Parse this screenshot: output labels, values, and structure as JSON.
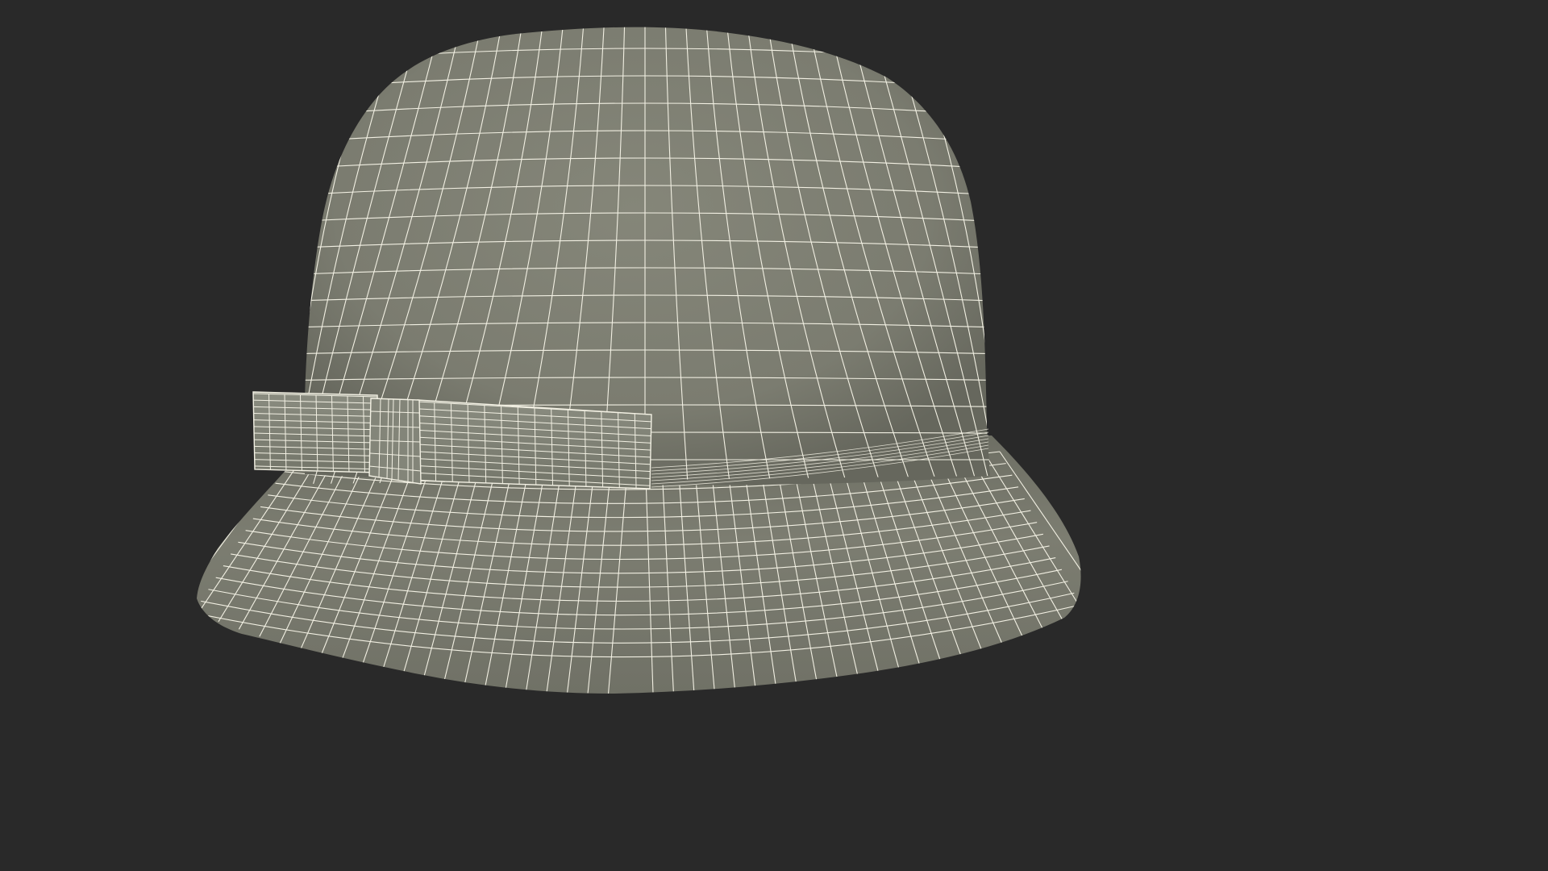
{
  "scene": {
    "subject": "bucket-hat-wireframe",
    "background_color": "#292929",
    "surface_color": "#7b7c70",
    "shadow_color": "#62635a",
    "bow_color": "#808276",
    "wire_color": "#f2f0e3"
  }
}
